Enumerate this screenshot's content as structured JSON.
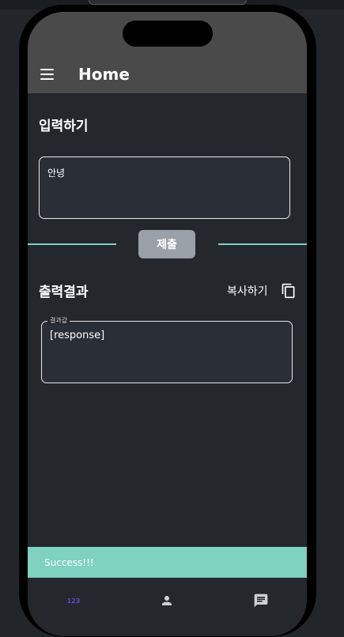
{
  "app_bar": {
    "title": "Home",
    "menu_icon": "menu-icon"
  },
  "input_section": {
    "title": "입력하기",
    "value": "안녕"
  },
  "submit_label": "제출",
  "output_section": {
    "title": "출력결과",
    "copy_label": "복사하기",
    "copy_icon": "copy-icon",
    "field_label": "결과값",
    "value": "[response]"
  },
  "snackbar": {
    "message": "Success!!!"
  },
  "bottom_nav": {
    "items": [
      {
        "label": "123",
        "icon": "numbers-icon",
        "selected": true
      },
      {
        "label": "",
        "icon": "person-icon",
        "selected": false
      },
      {
        "label": "",
        "icon": "chat-icon",
        "selected": false
      }
    ]
  },
  "colors": {
    "accent": "#7fd1c0",
    "selected_nav": "#5b4bd6",
    "app_bar": "#4a4a4a",
    "background": "#24282d"
  }
}
